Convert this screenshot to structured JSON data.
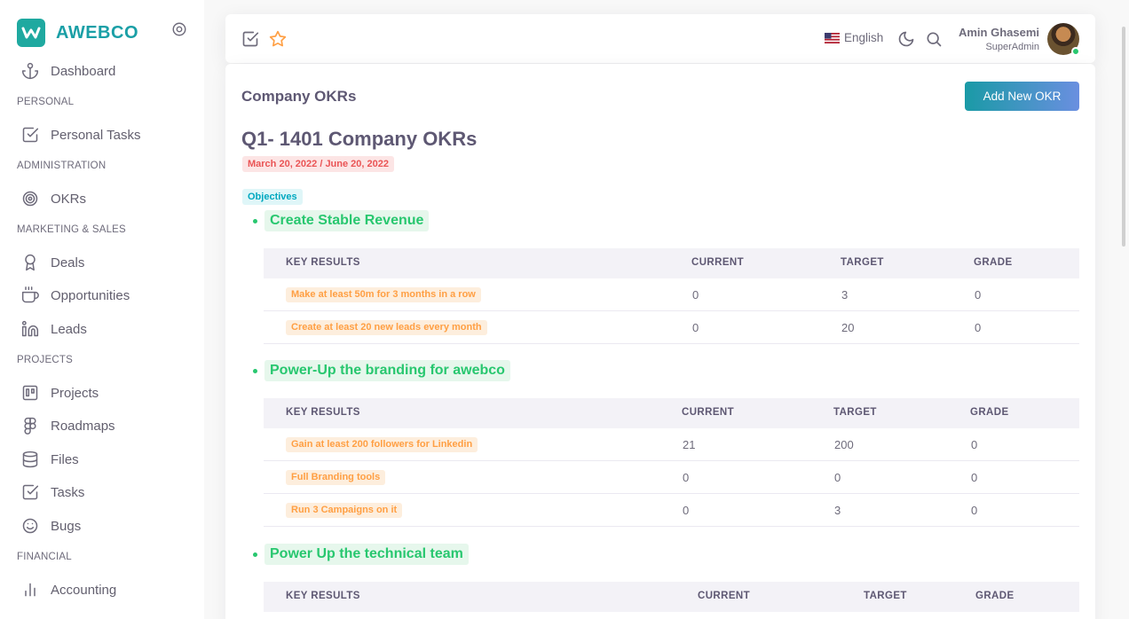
{
  "brand": {
    "name": "AWEBCO",
    "accent": "#1fa9a0"
  },
  "sidebar": {
    "items": [
      {
        "type": "item",
        "label": "Dashboard",
        "icon": "anchor-icon",
        "name": "sidebar-item-dashboard"
      },
      {
        "type": "header",
        "label": "PERSONAL"
      },
      {
        "type": "item",
        "label": "Personal Tasks",
        "icon": "check-square-icon",
        "name": "sidebar-item-personal-tasks"
      },
      {
        "type": "header",
        "label": "ADMINISTRATION"
      },
      {
        "type": "item",
        "label": "OKRs",
        "icon": "target-icon",
        "name": "sidebar-item-okrs"
      },
      {
        "type": "header",
        "label": "MARKETING & SALES"
      },
      {
        "type": "item",
        "label": "Deals",
        "icon": "award-icon",
        "name": "sidebar-item-deals"
      },
      {
        "type": "item",
        "label": "Opportunities",
        "icon": "coffee-icon",
        "name": "sidebar-item-opportunities"
      },
      {
        "type": "item",
        "label": "Leads",
        "icon": "linkedin-icon",
        "name": "sidebar-item-leads"
      },
      {
        "type": "header",
        "label": "PROJECTS"
      },
      {
        "type": "item",
        "label": "Projects",
        "icon": "trello-icon",
        "name": "sidebar-item-projects"
      },
      {
        "type": "item",
        "label": "Roadmaps",
        "icon": "figma-icon",
        "name": "sidebar-item-roadmaps"
      },
      {
        "type": "item",
        "label": "Files",
        "icon": "database-icon",
        "name": "sidebar-item-files"
      },
      {
        "type": "item",
        "label": "Tasks",
        "icon": "check-square-icon",
        "name": "sidebar-item-tasks"
      },
      {
        "type": "item",
        "label": "Bugs",
        "icon": "smile-icon",
        "name": "sidebar-item-bugs"
      },
      {
        "type": "header",
        "label": "FINANCIAL"
      },
      {
        "type": "item",
        "label": "Accounting",
        "icon": "bar-chart-icon",
        "name": "sidebar-item-accounting"
      }
    ]
  },
  "navbar": {
    "language": "English",
    "user_name": "Amin Ghasemi",
    "user_role": "SuperAdmin"
  },
  "page": {
    "title": "Company OKRs",
    "add_button": "Add New OKR",
    "okr_title": "Q1- 1401 Company OKRs",
    "date_range": "March 20, 2022 / June 20, 2022",
    "objectives_badge": "Objectives"
  },
  "table_headers": {
    "key_results": "KEY RESULTS",
    "current": "CURRENT",
    "target": "TARGET",
    "grade": "GRADE"
  },
  "objectives": [
    {
      "title": "Create Stable Revenue",
      "key_results": [
        {
          "name": "Make at least 50m for 3 months in a row",
          "current": "0",
          "target": "3",
          "grade": "0"
        },
        {
          "name": "Create at least 20 new leads every month",
          "current": "0",
          "target": "20",
          "grade": "0"
        }
      ]
    },
    {
      "title": "Power-Up the branding for awebco",
      "key_results": [
        {
          "name": "Gain at least 200 followers for Linkedin",
          "current": "21",
          "target": "200",
          "grade": "0"
        },
        {
          "name": "Full Branding tools",
          "current": "0",
          "target": "0",
          "grade": "0"
        },
        {
          "name": "Run 3 Campaigns on it",
          "current": "0",
          "target": "3",
          "grade": "0"
        }
      ]
    },
    {
      "title": "Power Up the technical team",
      "key_results": []
    }
  ]
}
